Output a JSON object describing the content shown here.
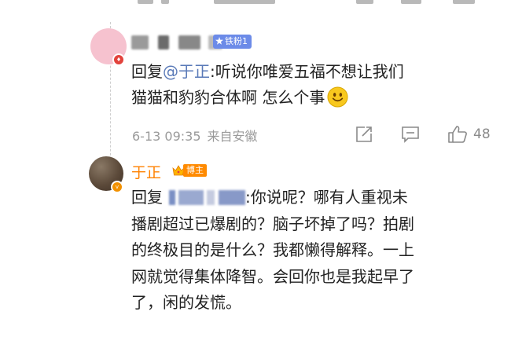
{
  "reply_1": {
    "user_badge": "铁粉1",
    "reply_prefix": "回复",
    "mention": "@于正",
    "text_line_1": ":听说你唯爱五福不想让我们",
    "text_line_2": "猫猫和豹豹合体啊 怎么个事",
    "emoji": "smiley-face",
    "time": "6-13 09:35",
    "source": "来自安徽",
    "like_count": "48"
  },
  "reply_2": {
    "username": "于正",
    "user_badge": "博主",
    "reply_prefix": "回复",
    "text_line_1": ":你说呢？哪有人重视未",
    "text_line_2": "播剧超过已爆剧的？脑子坏掉了吗？拍剧",
    "text_line_3": "的终极目的是什么？我都懒得解释。一上",
    "text_line_4": "网就觉得集体降智。会回你也是我起早了",
    "text_line_5": "了，闲的发慌。"
  },
  "colors": {
    "host_name": "#ff8200",
    "mention": "#5a7ab8",
    "fan_badge": "#6c8be8",
    "meta_text": "#9a9a9a"
  },
  "icons": [
    "share-icon",
    "comment-icon",
    "like-icon",
    "crown-icon",
    "verified-icon",
    "fan-icon",
    "smiley-icon"
  ]
}
